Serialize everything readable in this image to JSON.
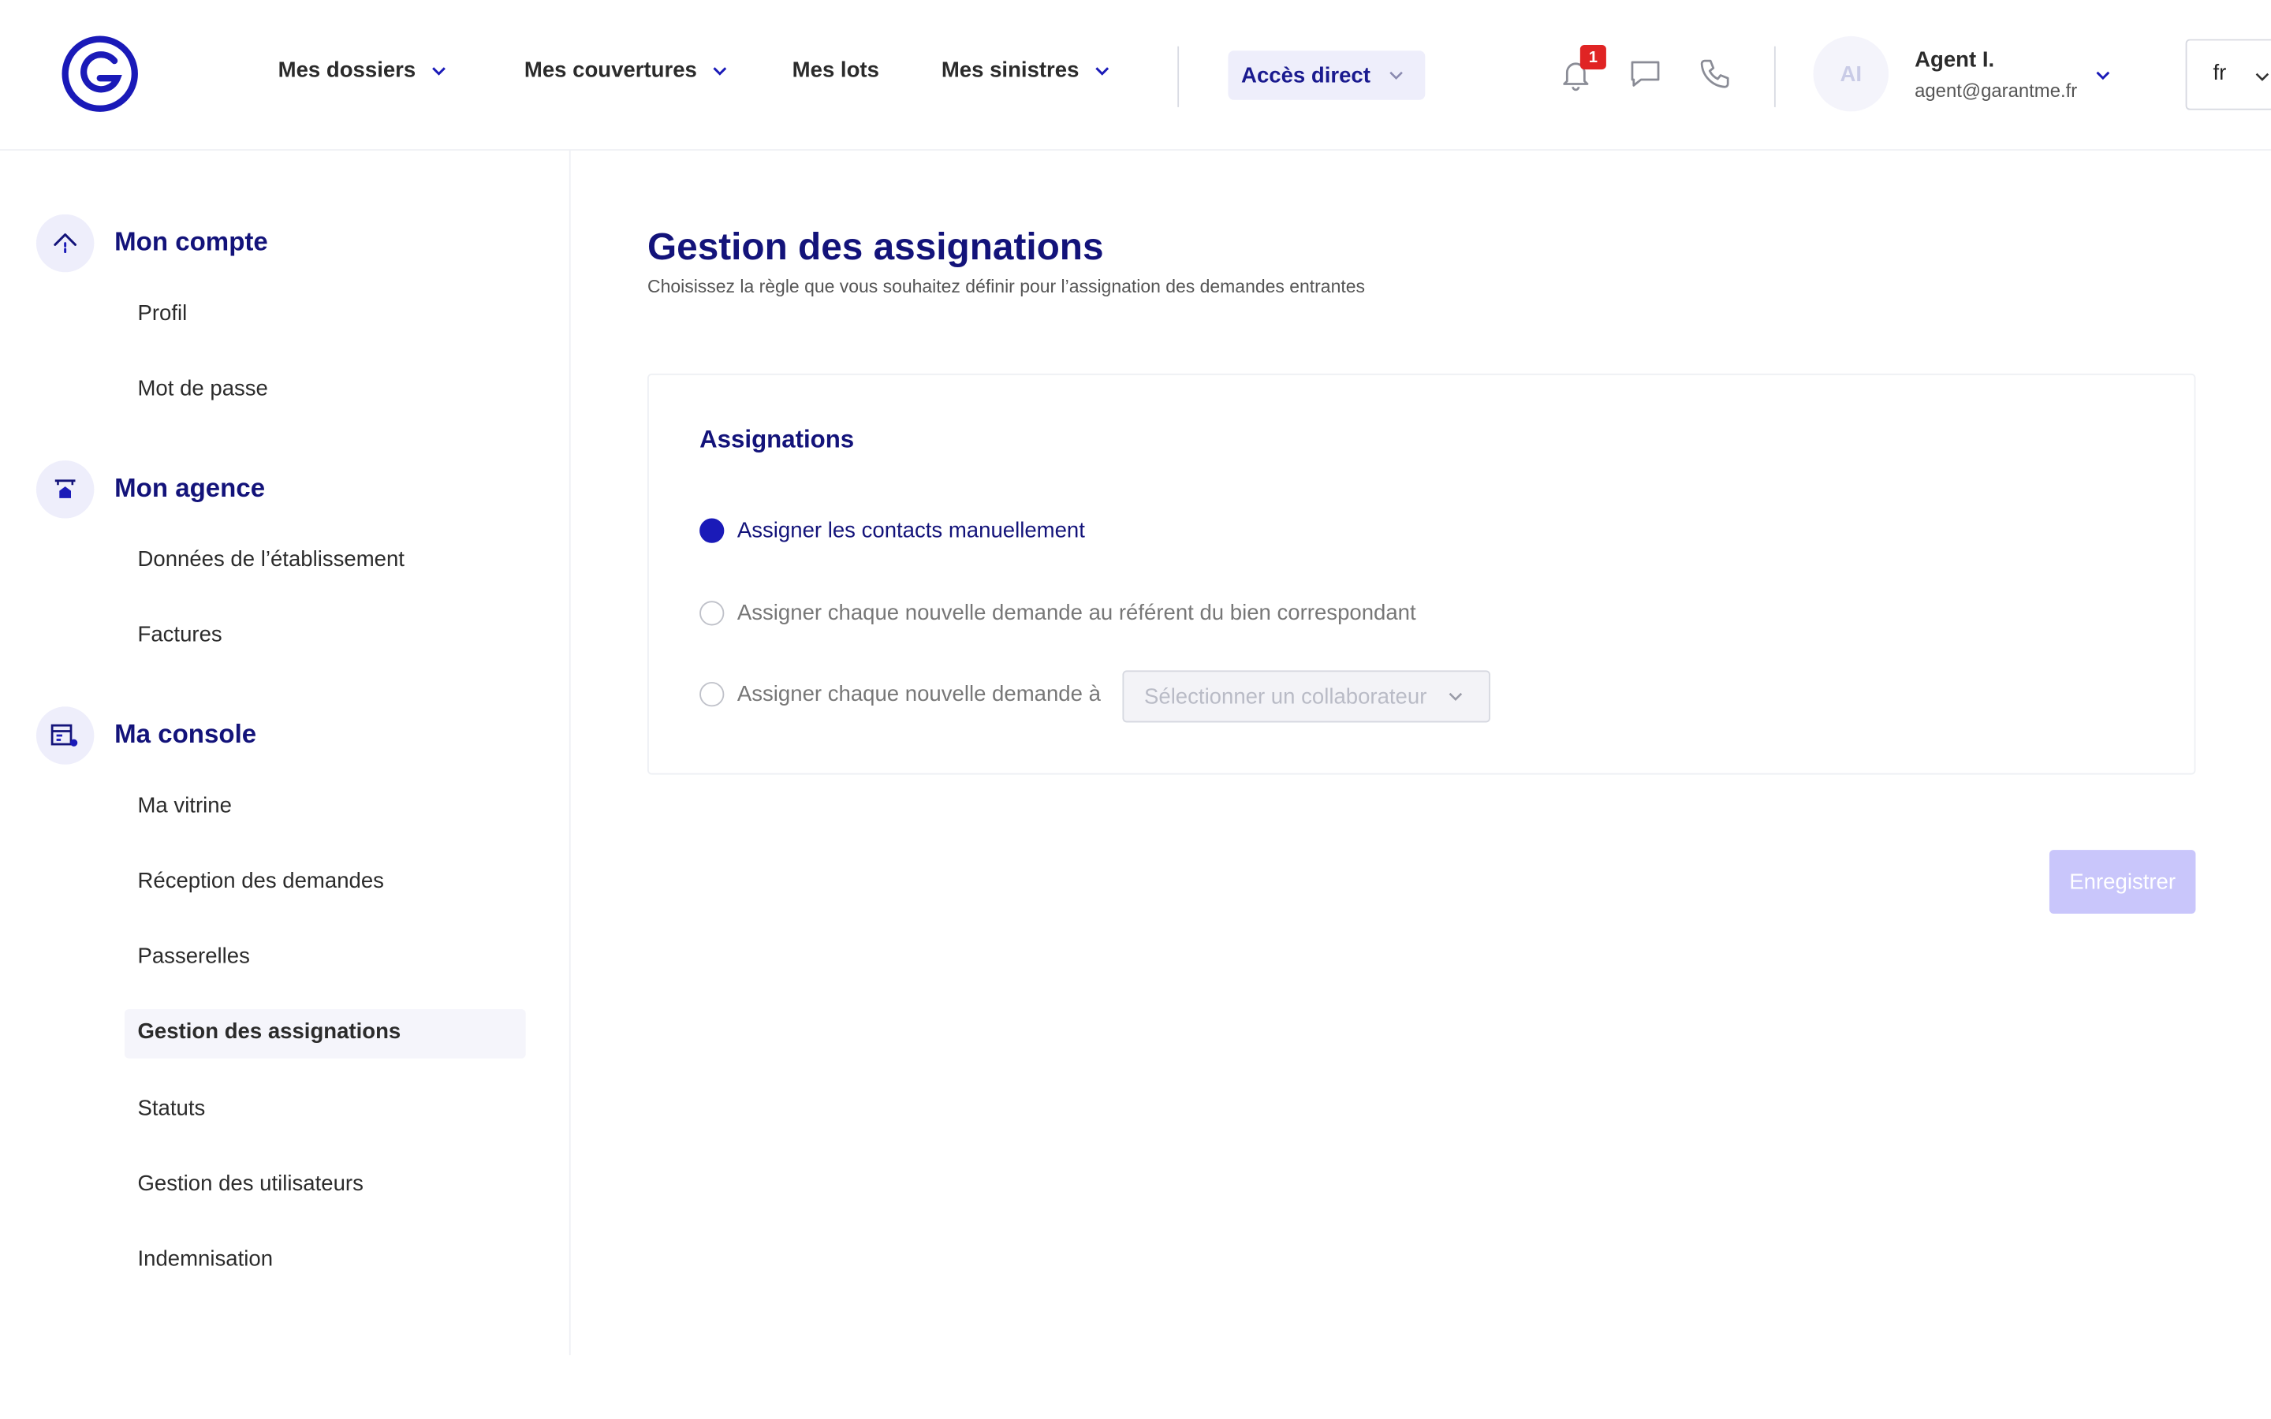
{
  "header": {
    "nav": [
      {
        "label": "Mes dossiers",
        "has_dropdown": true
      },
      {
        "label": "Mes couvertures",
        "has_dropdown": true
      },
      {
        "label": "Mes lots",
        "has_dropdown": false
      },
      {
        "label": "Mes sinistres",
        "has_dropdown": true
      }
    ],
    "acces_direct": "Accès direct",
    "notification_count": "1",
    "user": {
      "initials": "AI",
      "name": "Agent I.",
      "email": "agent@garantme.fr"
    },
    "language": "fr"
  },
  "sidebar": {
    "sections": [
      {
        "title": "Mon compte",
        "icon": "house-arrow-icon",
        "items": [
          "Profil",
          "Mot de passe"
        ]
      },
      {
        "title": "Mon agence",
        "icon": "agency-icon",
        "items": [
          "Données de l’établissement",
          "Factures"
        ]
      },
      {
        "title": "Ma console",
        "icon": "console-settings-icon",
        "items": [
          "Ma vitrine",
          "Réception des demandes",
          "Passerelles",
          "Gestion des assignations",
          "Statuts",
          "Gestion des utilisateurs",
          "Indemnisation"
        ]
      }
    ],
    "active_item": "Gestion des assignations"
  },
  "main": {
    "title": "Gestion des assignations",
    "subtitle": "Choisissez la règle que vous souhaitez définir pour l’assignation des demandes entrantes",
    "card": {
      "title": "Assignations",
      "options": [
        {
          "label": "Assigner les contacts manuellement",
          "checked": true
        },
        {
          "label": "Assigner chaque nouvelle demande au référent du bien correspondant",
          "checked": false
        },
        {
          "label": "Assigner chaque nouvelle demande à",
          "checked": false
        }
      ],
      "select_placeholder": "Sélectionner un collaborateur"
    },
    "save_label": "Enregistrer"
  },
  "colors": {
    "brand": "#1a1ab8",
    "title": "#13137a",
    "badge": "#e02424",
    "button_disabled": "#c9c6fb"
  }
}
